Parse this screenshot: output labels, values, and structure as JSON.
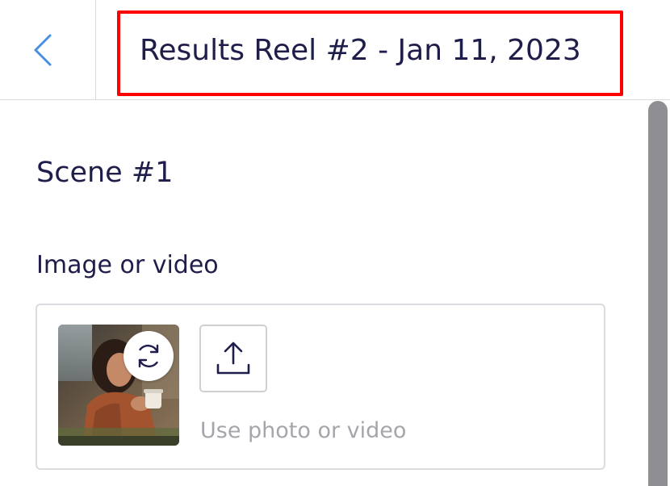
{
  "header": {
    "back_icon": "chevron-left-icon",
    "title": "Results Reel #2 - Jan 11, 2023",
    "highlight_color": "#ff0000"
  },
  "scene": {
    "title": "Scene #1",
    "media_label": "Image or video",
    "replace_icon": "refresh-icon",
    "upload_icon": "upload-icon",
    "upload_hint": "Use photo or video"
  },
  "colors": {
    "text_primary": "#1f1d4a",
    "accent_blue": "#4a90e2",
    "hint_gray": "#a5a5ab",
    "scrollbar": "#8f8f93"
  }
}
